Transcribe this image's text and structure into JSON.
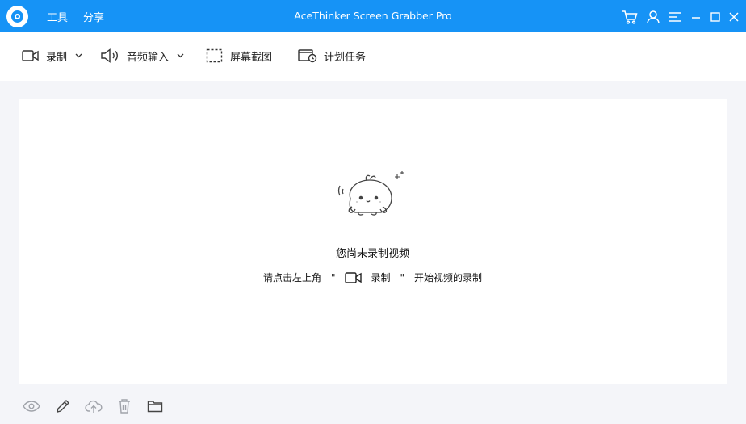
{
  "window": {
    "title": "AceThinker Screen Grabber Pro"
  },
  "menu": {
    "tools_label": "工具",
    "share_label": "分享"
  },
  "title_icons": [
    "cart-icon",
    "user-icon",
    "menu-icon",
    "minimize-icon",
    "maximize-icon",
    "close-icon"
  ],
  "toolbar": {
    "record_label": "录制",
    "audio_input_label": "音频输入",
    "screenshot_label": "屏幕截图",
    "scheduled_task_label": "计划任务"
  },
  "empty_state": {
    "title": "您尚未录制视频",
    "hint_prefix": "请点击左上角",
    "hint_open_quote": "\"",
    "hint_record_label": "录制",
    "hint_close_quote": "\"",
    "hint_suffix": "开始视频的录制"
  },
  "bottom_icons": [
    "preview-icon",
    "edit-icon",
    "upload-icon",
    "delete-icon",
    "folder-icon"
  ],
  "colors": {
    "accent": "#1693f6",
    "background": "#f4f5f9",
    "panel": "#ffffff",
    "icon_gray": "#a0a3aa"
  }
}
